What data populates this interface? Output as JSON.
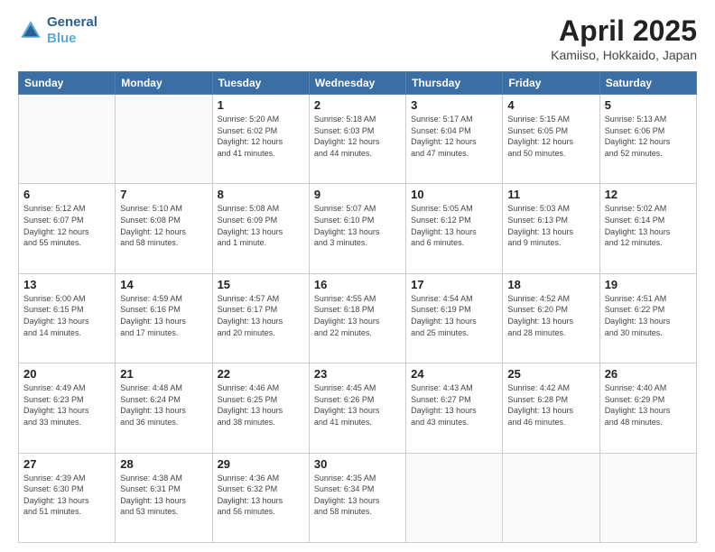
{
  "header": {
    "logo_line1": "General",
    "logo_line2": "Blue",
    "title": "April 2025",
    "subtitle": "Kamiiso, Hokkaido, Japan"
  },
  "weekdays": [
    "Sunday",
    "Monday",
    "Tuesday",
    "Wednesday",
    "Thursday",
    "Friday",
    "Saturday"
  ],
  "weeks": [
    [
      {
        "day": "",
        "info": ""
      },
      {
        "day": "",
        "info": ""
      },
      {
        "day": "1",
        "info": "Sunrise: 5:20 AM\nSunset: 6:02 PM\nDaylight: 12 hours\nand 41 minutes."
      },
      {
        "day": "2",
        "info": "Sunrise: 5:18 AM\nSunset: 6:03 PM\nDaylight: 12 hours\nand 44 minutes."
      },
      {
        "day": "3",
        "info": "Sunrise: 5:17 AM\nSunset: 6:04 PM\nDaylight: 12 hours\nand 47 minutes."
      },
      {
        "day": "4",
        "info": "Sunrise: 5:15 AM\nSunset: 6:05 PM\nDaylight: 12 hours\nand 50 minutes."
      },
      {
        "day": "5",
        "info": "Sunrise: 5:13 AM\nSunset: 6:06 PM\nDaylight: 12 hours\nand 52 minutes."
      }
    ],
    [
      {
        "day": "6",
        "info": "Sunrise: 5:12 AM\nSunset: 6:07 PM\nDaylight: 12 hours\nand 55 minutes."
      },
      {
        "day": "7",
        "info": "Sunrise: 5:10 AM\nSunset: 6:08 PM\nDaylight: 12 hours\nand 58 minutes."
      },
      {
        "day": "8",
        "info": "Sunrise: 5:08 AM\nSunset: 6:09 PM\nDaylight: 13 hours\nand 1 minute."
      },
      {
        "day": "9",
        "info": "Sunrise: 5:07 AM\nSunset: 6:10 PM\nDaylight: 13 hours\nand 3 minutes."
      },
      {
        "day": "10",
        "info": "Sunrise: 5:05 AM\nSunset: 6:12 PM\nDaylight: 13 hours\nand 6 minutes."
      },
      {
        "day": "11",
        "info": "Sunrise: 5:03 AM\nSunset: 6:13 PM\nDaylight: 13 hours\nand 9 minutes."
      },
      {
        "day": "12",
        "info": "Sunrise: 5:02 AM\nSunset: 6:14 PM\nDaylight: 13 hours\nand 12 minutes."
      }
    ],
    [
      {
        "day": "13",
        "info": "Sunrise: 5:00 AM\nSunset: 6:15 PM\nDaylight: 13 hours\nand 14 minutes."
      },
      {
        "day": "14",
        "info": "Sunrise: 4:59 AM\nSunset: 6:16 PM\nDaylight: 13 hours\nand 17 minutes."
      },
      {
        "day": "15",
        "info": "Sunrise: 4:57 AM\nSunset: 6:17 PM\nDaylight: 13 hours\nand 20 minutes."
      },
      {
        "day": "16",
        "info": "Sunrise: 4:55 AM\nSunset: 6:18 PM\nDaylight: 13 hours\nand 22 minutes."
      },
      {
        "day": "17",
        "info": "Sunrise: 4:54 AM\nSunset: 6:19 PM\nDaylight: 13 hours\nand 25 minutes."
      },
      {
        "day": "18",
        "info": "Sunrise: 4:52 AM\nSunset: 6:20 PM\nDaylight: 13 hours\nand 28 minutes."
      },
      {
        "day": "19",
        "info": "Sunrise: 4:51 AM\nSunset: 6:22 PM\nDaylight: 13 hours\nand 30 minutes."
      }
    ],
    [
      {
        "day": "20",
        "info": "Sunrise: 4:49 AM\nSunset: 6:23 PM\nDaylight: 13 hours\nand 33 minutes."
      },
      {
        "day": "21",
        "info": "Sunrise: 4:48 AM\nSunset: 6:24 PM\nDaylight: 13 hours\nand 36 minutes."
      },
      {
        "day": "22",
        "info": "Sunrise: 4:46 AM\nSunset: 6:25 PM\nDaylight: 13 hours\nand 38 minutes."
      },
      {
        "day": "23",
        "info": "Sunrise: 4:45 AM\nSunset: 6:26 PM\nDaylight: 13 hours\nand 41 minutes."
      },
      {
        "day": "24",
        "info": "Sunrise: 4:43 AM\nSunset: 6:27 PM\nDaylight: 13 hours\nand 43 minutes."
      },
      {
        "day": "25",
        "info": "Sunrise: 4:42 AM\nSunset: 6:28 PM\nDaylight: 13 hours\nand 46 minutes."
      },
      {
        "day": "26",
        "info": "Sunrise: 4:40 AM\nSunset: 6:29 PM\nDaylight: 13 hours\nand 48 minutes."
      }
    ],
    [
      {
        "day": "27",
        "info": "Sunrise: 4:39 AM\nSunset: 6:30 PM\nDaylight: 13 hours\nand 51 minutes."
      },
      {
        "day": "28",
        "info": "Sunrise: 4:38 AM\nSunset: 6:31 PM\nDaylight: 13 hours\nand 53 minutes."
      },
      {
        "day": "29",
        "info": "Sunrise: 4:36 AM\nSunset: 6:32 PM\nDaylight: 13 hours\nand 56 minutes."
      },
      {
        "day": "30",
        "info": "Sunrise: 4:35 AM\nSunset: 6:34 PM\nDaylight: 13 hours\nand 58 minutes."
      },
      {
        "day": "",
        "info": ""
      },
      {
        "day": "",
        "info": ""
      },
      {
        "day": "",
        "info": ""
      }
    ]
  ]
}
